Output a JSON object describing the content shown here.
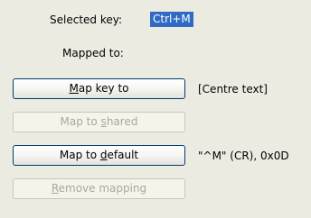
{
  "selected_key": {
    "label": "Selected key:",
    "value": "Ctrl+M"
  },
  "mapped_to": {
    "label": "Mapped to:"
  },
  "buttons": {
    "map_key_to": {
      "pre": "",
      "mnemonic": "M",
      "post": "ap key to",
      "enabled": true
    },
    "map_to_shared": {
      "pre": "Map to ",
      "mnemonic": "s",
      "post": "hared",
      "enabled": false
    },
    "map_to_default": {
      "pre": "Map to ",
      "mnemonic": "d",
      "post": "efault",
      "enabled": true
    },
    "remove_mapping": {
      "pre": "",
      "mnemonic": "R",
      "post": "emove mapping",
      "enabled": false
    }
  },
  "values": {
    "map_key_value": "[Centre text]",
    "default_value": "\"^M\" (CR), 0x0D"
  },
  "colors": {
    "background": "#ecebe2",
    "selection": "#316ac5",
    "button_border": "#003c74",
    "disabled_text": "#aca899"
  }
}
